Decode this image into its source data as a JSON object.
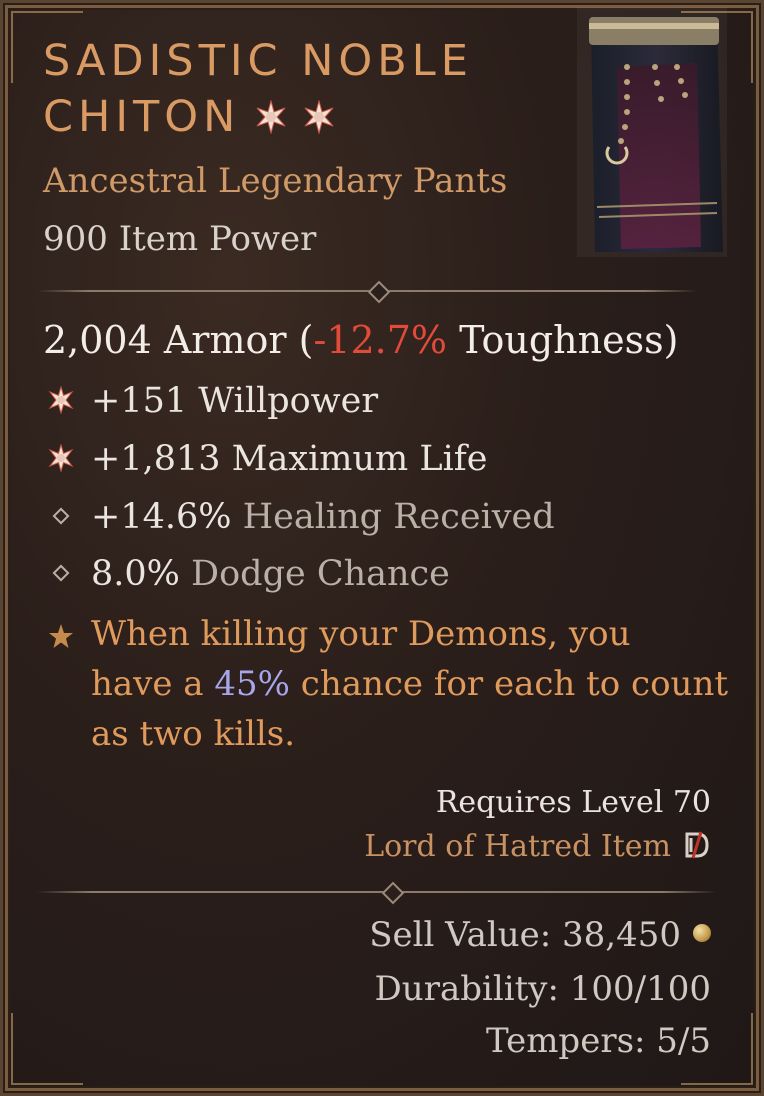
{
  "item": {
    "name_line1": "SADISTIC NOBLE",
    "name_line2": "CHITON",
    "type": "Ancestral Legendary Pants",
    "item_power": "900 Item Power"
  },
  "armor": {
    "value": "2,004 Armor (",
    "toughness_change": "-12.7%",
    "toughness_label": " Toughness)"
  },
  "affixes": [
    {
      "icon": "greater-affix-icon",
      "value": "+151",
      "label": " Willpower"
    },
    {
      "icon": "greater-affix-icon",
      "value": "+1,813",
      "label": " Maximum Life"
    },
    {
      "icon": "affix-diamond-icon",
      "value": "+14.6%",
      "label": " Healing Received"
    },
    {
      "icon": "affix-diamond-icon",
      "value": "8.0%",
      "label": " Dodge Chance"
    }
  ],
  "legendary_aspect": {
    "line1": "When killing your Demons, you",
    "line2_pre": "have a ",
    "line2_num": "45%",
    "line2_post": " chance for each to count",
    "line3": "as two kills."
  },
  "requirements": {
    "level": "Requires Level 70",
    "season": "Lord of Hatred Item"
  },
  "footer": {
    "sell_value": "Sell Value: 38,450",
    "durability": "Durability: 100/100",
    "tempers": "Tempers: 5/5"
  },
  "colors": {
    "title": "#d99a63",
    "legendary_text": "#e09a5c",
    "negative": "#e24a3a",
    "highlight_number": "#a7a6ea"
  }
}
